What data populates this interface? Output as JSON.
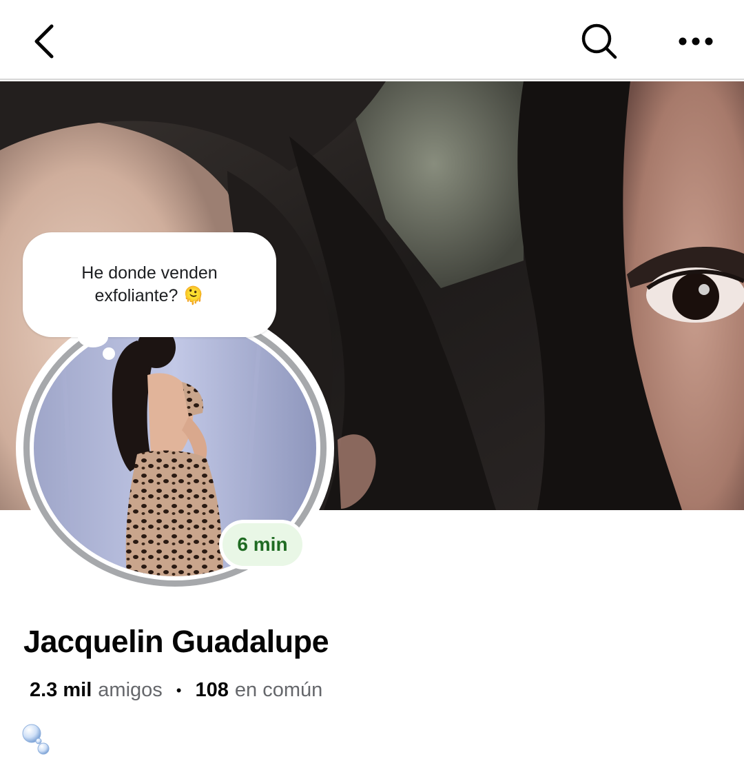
{
  "header": {
    "back_icon": "chevron-left-icon",
    "search_icon": "search-icon",
    "more_icon": "more-horizontal-icon"
  },
  "note": {
    "line1": "He donde venden",
    "line2": "exfoliante?",
    "emoji": "🫠"
  },
  "active_status": "6 min",
  "profile": {
    "name": "Jacquelin Guadalupe",
    "friends_count": "2.3 mil",
    "friends_label": "amigos",
    "mutual_count": "108",
    "mutual_label": "en común",
    "separator": "•"
  },
  "colors": {
    "active_badge_bg": "#e9f7e6",
    "active_badge_text": "#1f6b22",
    "secondary_text": "#65676b",
    "avatar_ring": "#a6a8ab"
  }
}
